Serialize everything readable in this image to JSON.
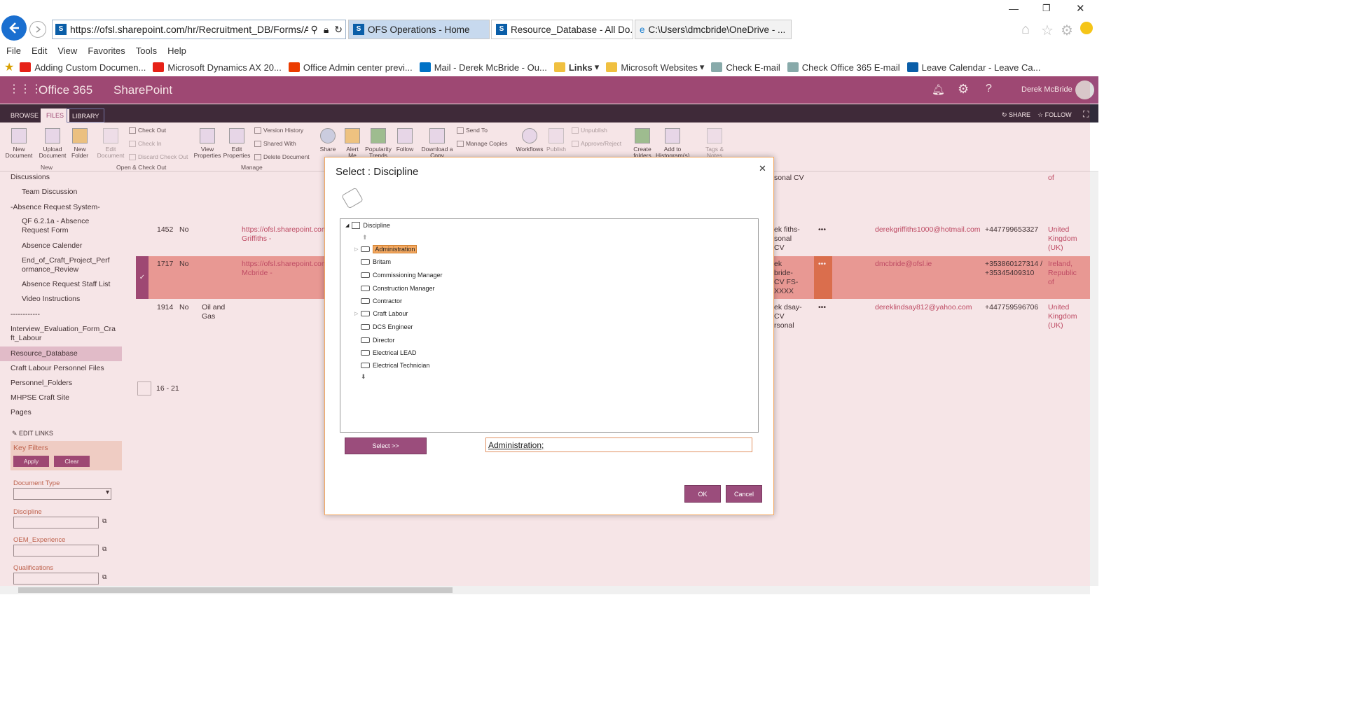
{
  "browser": {
    "address": "https://ofsl.sharepoint.com/hr/Recruitment_DB/Forms/All",
    "tabs": [
      {
        "label": "OFS Operations - Home"
      },
      {
        "label": "Resource_Database - All Do..."
      },
      {
        "label": "C:\\Users\\dmcbride\\OneDrive - ..."
      }
    ],
    "menu": [
      "File",
      "Edit",
      "View",
      "Favorites",
      "Tools",
      "Help"
    ],
    "favorites": [
      {
        "label": "Adding Custom Documen...",
        "color": "#e62117"
      },
      {
        "label": "Microsoft Dynamics AX 20...",
        "color": "#e62117"
      },
      {
        "label": "Office Admin center previ...",
        "color": "#eb3c00"
      },
      {
        "label": "Mail - Derek McBride - Ou...",
        "color": "#0072c6"
      },
      {
        "label": "Links",
        "color": "#f0c040"
      },
      {
        "label": "Microsoft Websites",
        "color": "#f0c040"
      },
      {
        "label": "Check E-mail",
        "color": "#8aa"
      },
      {
        "label": "Check Office 365 E-mail",
        "color": "#8aa"
      },
      {
        "label": "Leave Calendar - Leave Ca...",
        "color": "#0a5ea8"
      }
    ]
  },
  "suite": {
    "app": "Office 365",
    "site": "SharePoint",
    "user": "Derek McBride"
  },
  "ribbon": {
    "tabs": [
      "BROWSE",
      "FILES",
      "LIBRARY"
    ],
    "share": "SHARE",
    "follow": "FOLLOW",
    "buttons": [
      {
        "label": "New Document"
      },
      {
        "label": "Upload Document"
      },
      {
        "label": "New Folder"
      },
      {
        "label": "Edit Document"
      },
      {
        "label": "View Properties"
      },
      {
        "label": "Edit Properties"
      },
      {
        "label": "Share"
      },
      {
        "label": "Alert Me"
      },
      {
        "label": "Popularity Trends"
      },
      {
        "label": "Follow"
      },
      {
        "label": "Download a Copy"
      },
      {
        "label": "Workflows"
      },
      {
        "label": "Publish"
      },
      {
        "label": "Create folders"
      },
      {
        "label": "Add to Histogram(s)"
      },
      {
        "label": "Tags & Notes"
      }
    ],
    "small": [
      "Check Out",
      "Check In",
      "Discard Check Out",
      "Version History",
      "Shared With",
      "Delete Document",
      "Send To",
      "Manage Copies",
      "Unpublish",
      "Approve/Reject"
    ],
    "groups": [
      "New",
      "Open & Check Out",
      "Manage"
    ]
  },
  "nav": {
    "items": [
      "Discussions",
      "Team Discussion",
      "-Absence Request System-",
      "QF 6.2.1a - Absence Request Form",
      "Absence Calender",
      "End_of_Craft_Project_Performance_Review",
      "Absence Request Staff List",
      "Video Instructions",
      "------------",
      "Interview_Evaluation_Form_Craft_Labour",
      "Resource_Database",
      "Craft Labour Personnel Files",
      "Personnel_Folders",
      "MHPSE Craft Site",
      "Pages"
    ],
    "edit_links": "EDIT LINKS",
    "key_filters": "Key Filters",
    "apply": "Apply",
    "clear": "Clear",
    "filters": [
      "Document Type",
      "Discipline",
      "OEM_Experience",
      "Qualifications"
    ]
  },
  "list": {
    "rows": [
      {
        "id": "1452",
        "flag": "No",
        "sector": "",
        "link": "https://ofsl.sharepoint.com Griffiths - derekgriffiths100",
        "name": "ek fiths- sonal CV",
        "email": "derekgriffiths1000@hotmail.com",
        "phone": "+447799653327",
        "country": "United Kingdom (UK)"
      },
      {
        "id": "1717",
        "flag": "No",
        "sector": "",
        "link": "https://ofsl.sharepoint.com Mcbride - dmcbride@ofsl.",
        "name": "ek bride-CV FS- XXXX",
        "email": "dmcbride@ofsl.ie",
        "phone": "+353860127314 / +35345409310",
        "country": "Ireland, Republic of"
      },
      {
        "id": "1914",
        "flag": "No",
        "sector": "Oil and Gas",
        "link": "",
        "name": "ek dsay-CV rsonal",
        "email": "dereklindsay812@yahoo.com",
        "phone": "+447759596706",
        "country": "United Kingdom (UK)"
      }
    ],
    "top_fragment": "sonal CV",
    "top_country": "of",
    "paging": "16 - 21"
  },
  "dialog": {
    "title": "Select : Discipline",
    "root": "Discipline",
    "nodes": [
      "Administration",
      "Britam",
      "Commissioning Manager",
      "Construction Manager",
      "Contractor",
      "Craft Labour",
      "DCS Engineer",
      "Director",
      "Electrical LEAD",
      "Electrical Technician"
    ],
    "select_button": "Select >>",
    "selected_value": "Administration;",
    "ok": "OK",
    "cancel": "Cancel"
  },
  "colors": {
    "brand": "#9b4d7c",
    "ribbon_dark": "#2f2b3a",
    "link": "#c0506a",
    "highlight": "#f4a860"
  }
}
